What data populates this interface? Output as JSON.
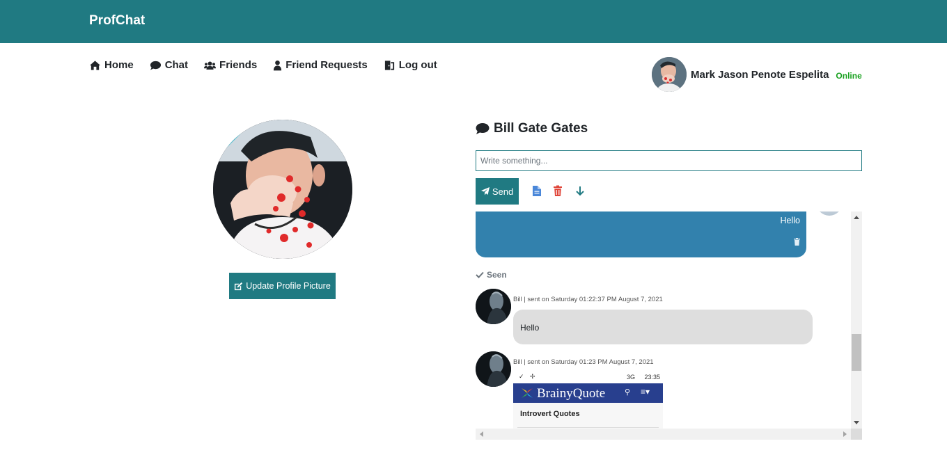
{
  "brand": "ProfChat",
  "nav": {
    "items": [
      {
        "label": "Home",
        "icon": "home-icon"
      },
      {
        "label": "Chat",
        "icon": "chat-bubble-icon"
      },
      {
        "label": "Friends",
        "icon": "users-icon"
      },
      {
        "label": "Friend Requests",
        "icon": "user-icon"
      },
      {
        "label": "Log out",
        "icon": "door-exit-icon"
      }
    ]
  },
  "user": {
    "name": "Mark Jason Penote Espelita",
    "status": "Online",
    "status_color": "#19a11f"
  },
  "profile": {
    "update_button": "Update Profile Picture"
  },
  "chat": {
    "title": "Bill Gate Gates",
    "input_placeholder": "Write something...",
    "send_label": "Send",
    "tool_icons": [
      "file-icon",
      "trash-icon",
      "arrow-down-icon"
    ],
    "messages": [
      {
        "direction": "outgoing",
        "text": "Hello",
        "status": "Seen"
      },
      {
        "direction": "incoming",
        "meta": "Bill | sent on Saturday 01:22:37 PM August 7, 2021",
        "text": "Hello"
      },
      {
        "direction": "incoming",
        "meta": "Bill | sent on Saturday 01:23 PM August 7, 2021",
        "image": {
          "status_time": "23:35",
          "status_network": "3G",
          "app_name": "BrainyQuote",
          "section": "Introvert Quotes"
        }
      }
    ]
  },
  "colors": {
    "primary": "#207a82",
    "outgoing_bubble": "#3281ad",
    "incoming_bubble": "#dedede",
    "delete_icon": "#e0463a",
    "file_icon": "#4a87d9"
  }
}
